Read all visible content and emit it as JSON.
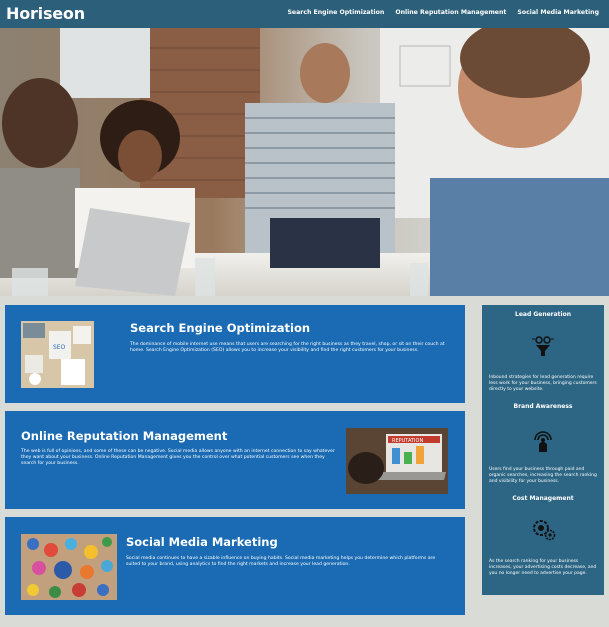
{
  "header": {
    "logo": "Horiseon",
    "nav": [
      {
        "label": "Search Engine Optimization"
      },
      {
        "label": "Online Reputation Management"
      },
      {
        "label": "Social Media Marketing"
      }
    ]
  },
  "cards": [
    {
      "title": "Search Engine Optimization",
      "text": "The dominance of mobile internet use means that users are searching for the right business as they travel, shop, or sit on their couch at home. Search Engine Optimization (SEO) allows you to increase your visibility and find the right customers for your business."
    },
    {
      "title": "Online Reputation Management",
      "text": "The web is full of opinions, and some of these can be negative. Social media allows anyone with an internet connection to say whatever they want about your business. Online Reputation Management gives you the control over what potential customers see when they search for your business."
    },
    {
      "title": "Social Media Marketing",
      "text": "Social media continues to have a sizable influence on buying habits. Social media marketing helps you determine which platforms are suited to your brand, using analytics to find the right markets and increase your lead generation."
    }
  ],
  "benefits": [
    {
      "title": "Lead Generation",
      "text": "Inbound strategies for lead generation require less work for your business, bringing customers directly to your website."
    },
    {
      "title": "Brand Awareness",
      "text": "Users find your business through paid and organic searches, increasing the search ranking and visibility for your business."
    },
    {
      "title": "Cost Management",
      "text": "As the search ranking for your business increases, your advertising costs decrease, and you no longer need to advertise your page."
    }
  ],
  "thumbs": {
    "seo_badge": "SEO",
    "reputation_badge": "REPUTATION"
  },
  "colors": {
    "header": "#2b5f7a",
    "card": "#1a6bb3",
    "sidebar": "#2c6684",
    "page": "#d9dcd6"
  }
}
